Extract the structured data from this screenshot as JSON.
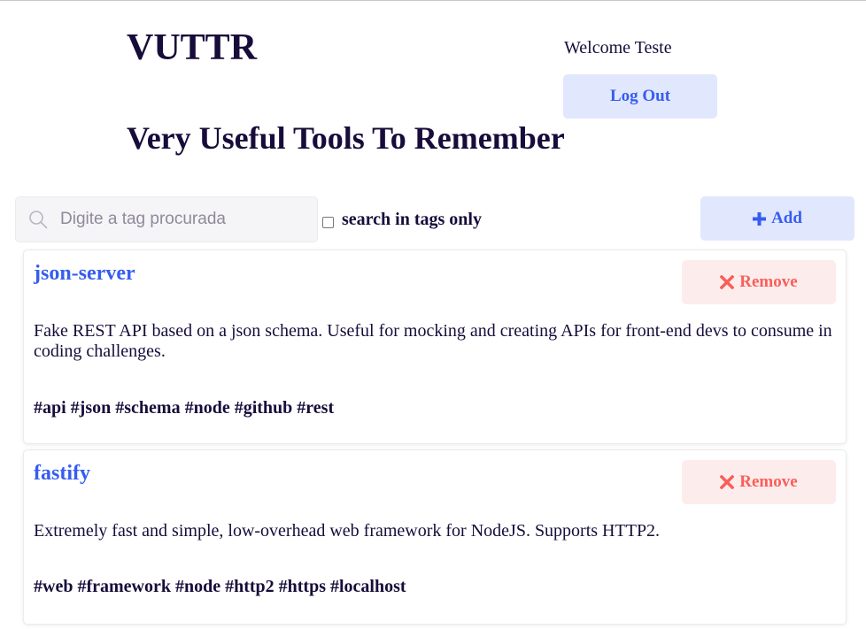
{
  "header": {
    "app_title": "VUTTR",
    "subtitle": "Very Useful Tools To Remember",
    "welcome": "Welcome Teste",
    "logout_label": "Log Out"
  },
  "toolbar": {
    "search_placeholder": "Digite a tag procurada",
    "search_value": "",
    "tags_only_label": "search in tags only",
    "tags_only_checked": false,
    "add_label": "Add"
  },
  "tools": [
    {
      "title": "json-server",
      "remove_label": "Remove",
      "description": "Fake REST API based on a json schema. Useful for mocking and creating APIs for front-end devs to consume in coding challenges.",
      "tags": "#api #json #schema #node #github #rest"
    },
    {
      "title": "fastify",
      "remove_label": "Remove",
      "description": "Extremely fast and simple, low-overhead web framework for NodeJS. Supports HTTP2.",
      "tags": "#web #framework #node #http2 #https #localhost"
    }
  ],
  "colors": {
    "dark": "#170c3a",
    "blue": "#365df0",
    "blue_bg": "#e1e7fd",
    "red": "#f95e5a",
    "red_bg": "#fcedec"
  },
  "icons": {
    "search": "search-icon",
    "add": "plus-icon",
    "remove": "close-icon"
  }
}
